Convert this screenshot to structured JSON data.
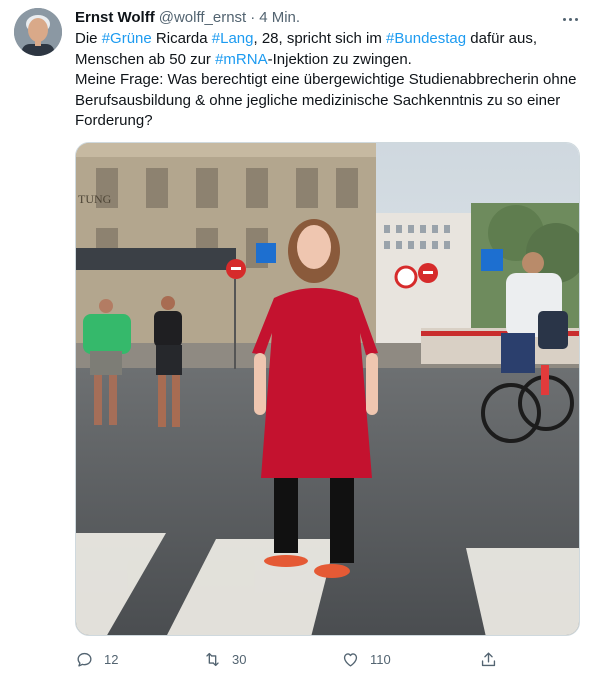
{
  "author": {
    "name": "Ernst Wolff",
    "handle": "@wolff_ernst",
    "separator": "·",
    "time": "4 Min."
  },
  "tweet_text": {
    "line1": [
      {
        "t": "Die ",
        "tag": false
      },
      {
        "t": "#Grüne",
        "tag": true
      },
      {
        "t": " Ricarda ",
        "tag": false
      },
      {
        "t": "#Lang",
        "tag": true
      },
      {
        "t": ", 28, spricht sich im ",
        "tag": false
      },
      {
        "t": "#Bundestag",
        "tag": true
      },
      {
        "t": " dafür aus,",
        "tag": false
      }
    ],
    "line2": [
      {
        "t": "Menschen ab 50 zur ",
        "tag": false
      },
      {
        "t": "#mRNA",
        "tag": true
      },
      {
        "t": "-Injektion zu zwingen.",
        "tag": false
      }
    ],
    "line3": "Meine Frage: Was berechtigt eine übergewichtige Studienabbrecherin ohne",
    "line4": "Berufsausbildung & ohne jegliche medizinische Sachkenntnis zu so einer",
    "line5": "Forderung?"
  },
  "photo_sign_text": "TUNG",
  "actions": {
    "reply_count": "12",
    "retweet_count": "30",
    "like_count": "110"
  },
  "colors": {
    "link": "#1d9bf0",
    "secondary_text": "#536471",
    "dress": "#c4122f"
  },
  "icons": {
    "more": "more-horizontal-icon",
    "reply": "reply-icon",
    "retweet": "retweet-icon",
    "like": "heart-icon",
    "share": "share-icon"
  }
}
